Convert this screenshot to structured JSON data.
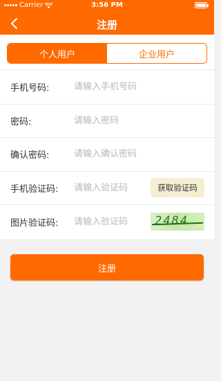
{
  "status_bar": {
    "carrier": "Carrier",
    "time": "3:56 PM"
  },
  "nav": {
    "title": "注册",
    "back_icon": "chevron-left-icon"
  },
  "segment": {
    "tabs": [
      {
        "label": "个人用户",
        "active": true
      },
      {
        "label": "企业用户",
        "active": false
      }
    ]
  },
  "form": {
    "phone": {
      "label": "手机号码:",
      "placeholder": "请输入手机号码"
    },
    "password": {
      "label": "密码:",
      "placeholder": "请输入密码"
    },
    "confirm_password": {
      "label": "确认密码:",
      "placeholder": "请输入确认密码"
    },
    "sms_code": {
      "label": "手机验证码:",
      "placeholder": "请输入验证码",
      "button_label": "获取验证码"
    },
    "image_code": {
      "label": "图片验证码:",
      "placeholder": "请输入验证码",
      "captcha_text": "2484"
    }
  },
  "submit": {
    "label": "注册"
  },
  "colors": {
    "accent": "#ff6a00",
    "background": "#f2f2f2"
  }
}
